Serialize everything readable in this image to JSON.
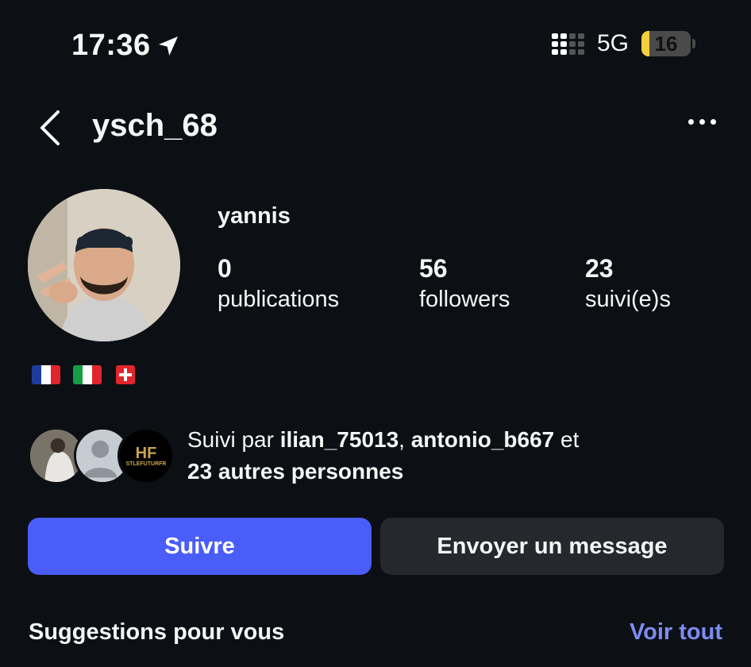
{
  "status_bar": {
    "time": "17:36",
    "network": "5G",
    "battery_level": "16",
    "battery_fraction": 0.16,
    "battery_color": "#f4d03f"
  },
  "header": {
    "username": "ysch_68"
  },
  "profile": {
    "display_name": "yannis",
    "stats": [
      {
        "value": "0",
        "label": "publications"
      },
      {
        "value": "56",
        "label": "followers"
      },
      {
        "value": "23",
        "label": "suivi(e)s"
      }
    ],
    "bio_flags": [
      "flag-france",
      "flag-italy",
      "flag-switzerland"
    ]
  },
  "followed_by": {
    "prefix": "Suivi par ",
    "user1": "ilian_75013",
    "separator": ", ",
    "user2": "antonio_b667",
    "conjunction": " et",
    "others": "23 autres personnes",
    "avatar3_text_top": "HF",
    "avatar3_text_bottom": "STLEFUTURFR"
  },
  "actions": {
    "follow_label": "Suivre",
    "message_label": "Envoyer un message",
    "follow_color": "#4a5df9"
  },
  "suggestions": {
    "title": "Suggestions pour vous",
    "see_all": "Voir tout"
  }
}
